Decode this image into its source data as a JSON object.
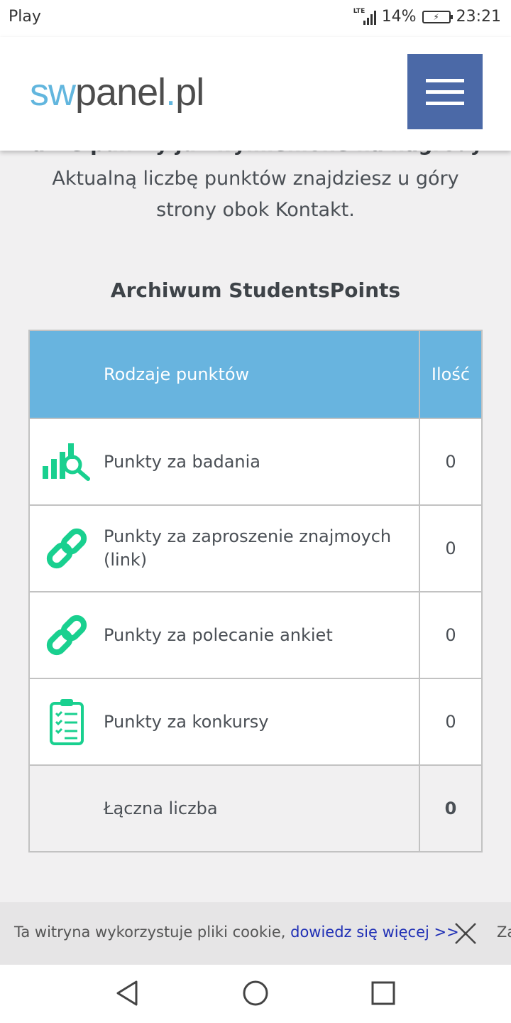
{
  "status_bar": {
    "carrier": "Play",
    "network": "LTE",
    "battery_percent": "14%",
    "time": "23:21"
  },
  "header": {
    "logo_sw": "sw",
    "logo_panel": "panel",
    "logo_dot": ".",
    "logo_tld": "pl"
  },
  "intro": {
    "cut_line": "także punkty już wymienione na nagrody.",
    "text": "Aktualną liczbę punktów znajdziesz u góry strony obok Kontakt."
  },
  "section_title": "Archiwum StudentsPoints",
  "table": {
    "header_name": "Rodzaje punktów",
    "header_qty": "Ilość",
    "rows": [
      {
        "icon": "research-chart-icon",
        "label": "Punkty za badania",
        "value": "0"
      },
      {
        "icon": "link-icon",
        "label": "Punkty za zaproszenie znajmoych (link)",
        "value": "0"
      },
      {
        "icon": "link-icon",
        "label": "Punkty za polecanie ankiet",
        "value": "0"
      },
      {
        "icon": "clipboard-checklist-icon",
        "label": "Punkty za konkursy",
        "value": "0"
      }
    ],
    "total_label": "Łączna liczba",
    "total_value": "0"
  },
  "cookie": {
    "text": "Ta witryna wykorzystuje pliki cookie, ",
    "link": "dowiedz się więcej >>",
    "accept_partial": "Za"
  },
  "colors": {
    "accent_blue": "#68b4df",
    "menu_blue": "#4b69a7",
    "icon_green": "#19d08f",
    "link_blue": "#1f2fb5"
  }
}
